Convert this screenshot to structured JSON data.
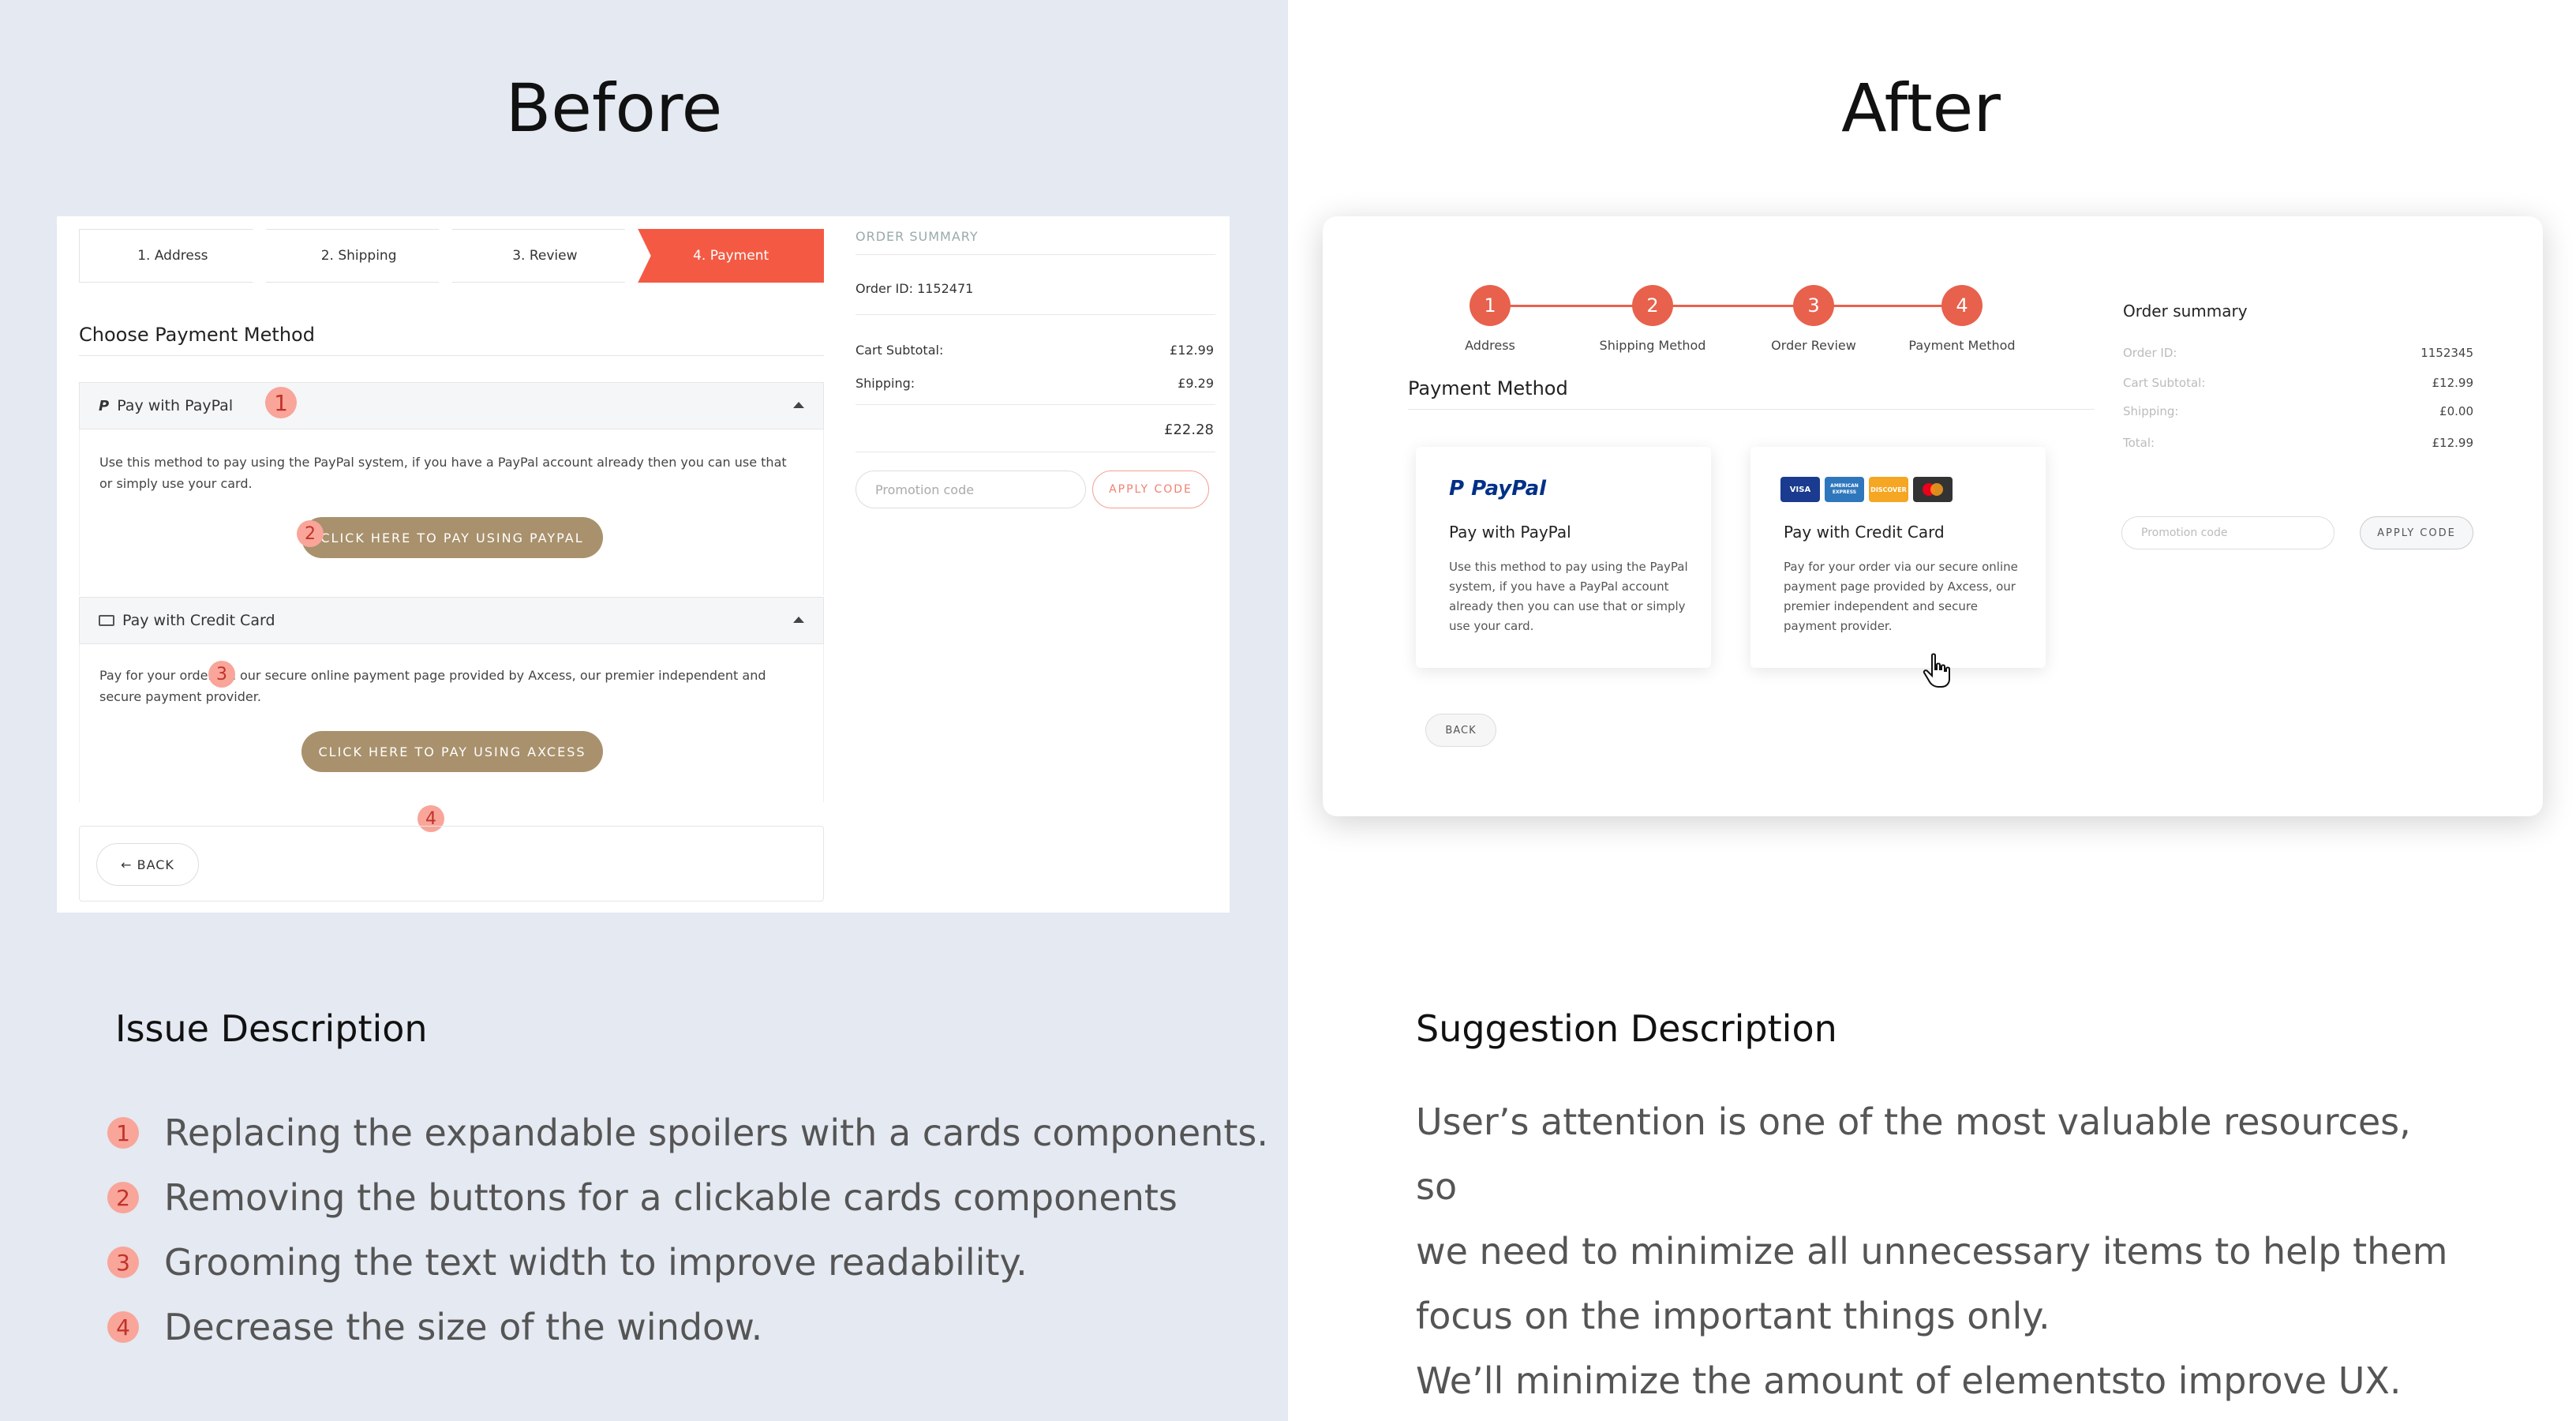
{
  "headings": {
    "before": "Before",
    "after": "After"
  },
  "before": {
    "steps": [
      "1. Address",
      "2. Shipping",
      "3. Review",
      "4. Payment"
    ],
    "title": "Choose Payment Method",
    "paypal": {
      "header": "Pay with PayPal",
      "text": "Use this method to pay using the PayPal system, if you have a PayPal account already then you can use that or simply use your card.",
      "button": "CLICK HERE TO PAY USING PAYPAL"
    },
    "card": {
      "header": "Pay with Credit Card",
      "text": "Pay for your order via our secure online payment page provided by Axcess, our premier independent and secure payment provider.",
      "button": "CLICK HERE TO PAY USING AXCESS"
    },
    "back": "← BACK",
    "summary": {
      "label": "ORDER SUMMARY",
      "order_id": "Order ID: 1152471",
      "subtotal_label": "Cart Subtotal:",
      "subtotal": "£12.99",
      "shipping_label": "Shipping:",
      "shipping": "£9.29",
      "total": "£22.28",
      "promo_placeholder": "Promotion code",
      "apply": "APPLY CODE"
    },
    "badges": [
      "1",
      "2",
      "3",
      "4"
    ]
  },
  "after": {
    "steps": [
      {
        "num": "1",
        "label": "Address"
      },
      {
        "num": "2",
        "label": "Shipping Method"
      },
      {
        "num": "3",
        "label": "Order Review"
      },
      {
        "num": "4",
        "label": "Payment Method"
      }
    ],
    "title": "Payment Method",
    "paypal_card": {
      "logo": "PayPal",
      "title": "Pay with PayPal",
      "text": "Use this method to pay using the PayPal system, if you have a PayPal account already then you can use that or simply use your card."
    },
    "credit_card": {
      "logos": [
        "VISA",
        "AMERICAN EXPRESS",
        "DISCOVER",
        "mastercard"
      ],
      "title": "Pay with Credit Card",
      "text": "Pay for your order via our secure online payment page provided by Axcess, our premier independent and secure payment provider."
    },
    "back": "BACK",
    "summary": {
      "title": "Order summary",
      "rows": [
        {
          "label": "Order ID:",
          "value": "1152345"
        },
        {
          "label": "Cart Subtotal:",
          "value": "£12.99"
        },
        {
          "label": "Shipping:",
          "value": "£0.00"
        },
        {
          "label": "Total:",
          "value": "£12.99"
        }
      ],
      "promo_placeholder": "Promotion code",
      "apply": "APPLY CODE"
    }
  },
  "issue": {
    "title": "Issue Description",
    "items": [
      {
        "num": "1",
        "text": "Replacing the expandable spoilers with a cards components."
      },
      {
        "num": "2",
        "text": "Removing the buttons for a clickable cards components"
      },
      {
        "num": "3",
        "text": "Grooming the text width to improve readability."
      },
      {
        "num": "4",
        "text": "Decrease the size of the window."
      }
    ]
  },
  "suggestion": {
    "title": "Suggestion Description",
    "lines": [
      "User’s attention is one of the most valuable resources, so",
      "we need to minimize all unnecessary items to help them",
      "focus on the important things only.",
      "We’ll minimize the amount of elementsto improve UX."
    ]
  },
  "colors": {
    "accent": "#e8614c",
    "badge": "#f9a59a",
    "brown": "#a8916c",
    "left_bg": "#e4e9f2"
  }
}
